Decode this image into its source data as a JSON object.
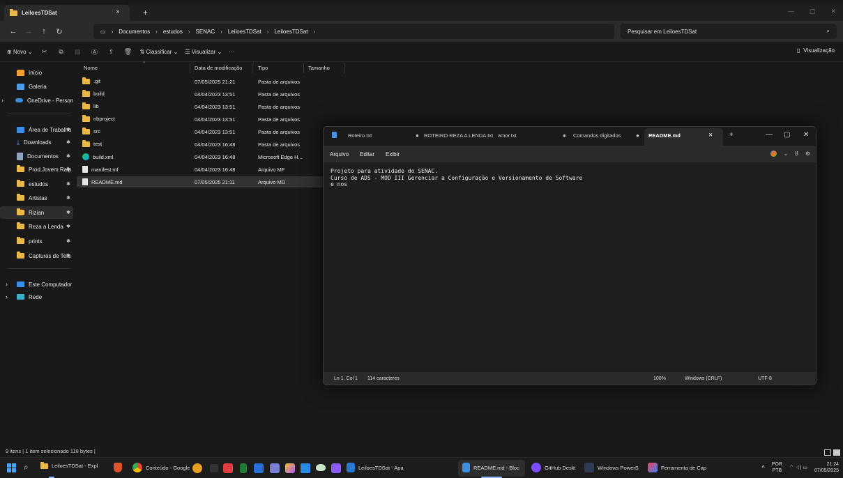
{
  "explorer": {
    "tab_title": "LeiloesTDSat",
    "tab_close": "×",
    "tab_new": "+",
    "window_controls": [
      "—",
      "▢",
      "✕"
    ],
    "nav": {
      "back": "←",
      "forward": "→",
      "up": "↑",
      "refresh": "↻"
    },
    "address_icon": "▭",
    "breadcrumb": [
      "Documentos",
      "estudos",
      "SENAC",
      "LeiloesTDSat",
      "LeiloesTDSat"
    ],
    "search_placeholder": "Pesquisar em LeiloesTDSat",
    "search_icon": "⌕",
    "cmdbar": {
      "new_label": "Novo",
      "sort_label": "Classificar",
      "view_label": "Visualizar",
      "more": "···",
      "preview_label": "Visualização"
    },
    "sidebar": {
      "home": "Início",
      "gallery": "Galeria",
      "onedrive": "OneDrive - Persona",
      "pinned": [
        "Área de Trabalho",
        "Downloads",
        "Documentos",
        "Prod.Jovem Ralp",
        "estudos",
        "Artistas",
        "Rizian",
        "Reza a Lenda",
        "prints",
        "Capturas de Tela"
      ],
      "this_pc": "Este Computador",
      "network": "Rede"
    },
    "columns": [
      "Nome",
      "Data de modificação",
      "Tipo",
      "Tamanho"
    ],
    "files": [
      {
        "name": ".git",
        "date": "07/05/2025 21:21",
        "type": "Pasta de arquivos",
        "icon": "folder"
      },
      {
        "name": "build",
        "date": "04/04/2023 13:51",
        "type": "Pasta de arquivos",
        "icon": "folder"
      },
      {
        "name": "lib",
        "date": "04/04/2023 13:51",
        "type": "Pasta de arquivos",
        "icon": "folder"
      },
      {
        "name": "nbproject",
        "date": "04/04/2023 13:51",
        "type": "Pasta de arquivos",
        "icon": "folder"
      },
      {
        "name": "src",
        "date": "04/04/2023 13:51",
        "type": "Pasta de arquivos",
        "icon": "folder"
      },
      {
        "name": "test",
        "date": "04/04/2023 16:48",
        "type": "Pasta de arquivos",
        "icon": "folder"
      },
      {
        "name": "build.xml",
        "date": "04/04/2023 16:48",
        "type": "Microsoft Edge H...",
        "icon": "edge"
      },
      {
        "name": "manifest.mf",
        "date": "04/04/2023 16:48",
        "type": "Arquivo MF",
        "icon": "file"
      },
      {
        "name": "README.md",
        "date": "07/05/2025 21:11",
        "type": "Arquivo MD",
        "icon": "file"
      }
    ],
    "status": "9 itens  |  1 item selecionado 118 bytes  |"
  },
  "notepad": {
    "tabs": [
      "Roteiro.txt",
      "ROTEIRO REZA A LENDA.txt",
      "amor.txt",
      "Comandos digitados",
      "README.md"
    ],
    "tab_close": "✕",
    "tab_new": "+",
    "window_controls": [
      "—",
      "▢",
      "✕"
    ],
    "menu": [
      "Arquivo",
      "Editar",
      "Exibir"
    ],
    "menu_right": {
      "chevron": "⌄",
      "account": "ȣ",
      "settings": "⚙"
    },
    "content": "Projeto para atividade do SENAC.\nCurso de ADS - MOD III Gerenciar a Configuração e Versionamento de Software\ne nos",
    "status": {
      "position": "Ln 1, Col 1",
      "chars": "114 caracteres",
      "zoom": "100%",
      "eol": "Windows (CRLF)",
      "encoding": "UTF-8"
    }
  },
  "taskbar": {
    "search_icon": "⌕",
    "items": [
      "LeiloesTDSat - Expl",
      "Conteúdo - Google",
      "LeiloesTDSat - Apa",
      "README.md - Bloc",
      "GitHub Deskt",
      "Windows PowerS",
      "Ferramenta de Cap"
    ],
    "tray_chevron": "^",
    "lang_top": "POR",
    "lang_bottom": "PTB",
    "tray_icons": "⌔ ◁) ▭",
    "time": "21:24",
    "date": "07/05/2025"
  }
}
